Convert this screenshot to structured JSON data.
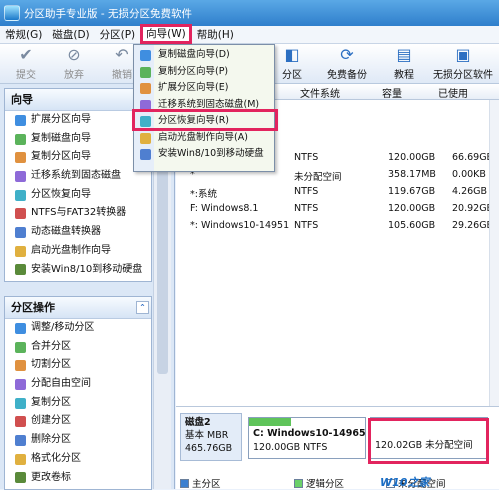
{
  "window": {
    "title": "分区助手专业版 - 无损分区免费软件"
  },
  "menu": {
    "items": [
      "常规(G)",
      "磁盘(D)",
      "分区(P)",
      "向导(W)",
      "帮助(H)"
    ]
  },
  "toolbar": {
    "buttons": [
      "提交",
      "放弃",
      "撤销",
      "分区",
      "免费备份",
      "教程",
      "无损分区软件"
    ]
  },
  "wizard_menu": {
    "items": [
      "复制磁盘向导(D)",
      "复制分区向导(P)",
      "扩展分区向导(E)",
      "迁移系统到固态磁盘(M)",
      "分区恢复向导(R)",
      "启动光盘制作向导(A)",
      "安装Win8/10到移动硬盘"
    ]
  },
  "left_pane": {
    "wizard_section": {
      "title": "向导",
      "items": [
        "扩展分区向导",
        "复制磁盘向导",
        "复制分区向导",
        "迁移系统到固态磁盘",
        "分区恢复向导",
        "NTFS与FAT32转换器",
        "动态磁盘转换器",
        "启动光盘制作向导",
        "安装Win8/10到移动硬盘"
      ]
    },
    "ops_section": {
      "title": "分区操作",
      "items": [
        "调整/移动分区",
        "合并分区",
        "切割分区",
        "分配自由空间",
        "复制分区",
        "创建分区",
        "删除分区",
        "格式化分区",
        "更改卷标"
      ]
    }
  },
  "table": {
    "headers": {
      "fs": "文件系统",
      "capacity": "容量",
      "used": "已使用"
    },
    "rows": [
      {
        "name": "",
        "fs": "NTFS",
        "capacity": "120.00GB",
        "used": "66.69GB"
      },
      {
        "name": "*",
        "fs": "未分配空间",
        "capacity": "358.17MB",
        "used": "0.00KB"
      },
      {
        "name": "*:系统",
        "fs": "NTFS",
        "capacity": "119.67GB",
        "used": "4.26GB"
      },
      {
        "name": "F: Windows8.1",
        "fs": "NTFS",
        "capacity": "120.00GB",
        "used": "20.92GB"
      },
      {
        "name": "*: Windows10-14951",
        "fs": "NTFS",
        "capacity": "105.60GB",
        "used": "29.26GB"
      }
    ]
  },
  "disk": {
    "name": "磁盘2",
    "type": "基本 MBR",
    "size": "465.76GB",
    "partitions": [
      {
        "label": "C: Windows10-14965",
        "detail": "120.00GB NTFS"
      },
      {
        "label": "",
        "detail": "120.02GB 未分配空间"
      }
    ]
  },
  "legend": [
    "主分区",
    "逻辑分区",
    "未分配空间"
  ],
  "watermark": "W10之家",
  "colors": {
    "highlight": "#e2245e",
    "primary": "#2f7fcc",
    "used_bar": "#5fc45a"
  }
}
